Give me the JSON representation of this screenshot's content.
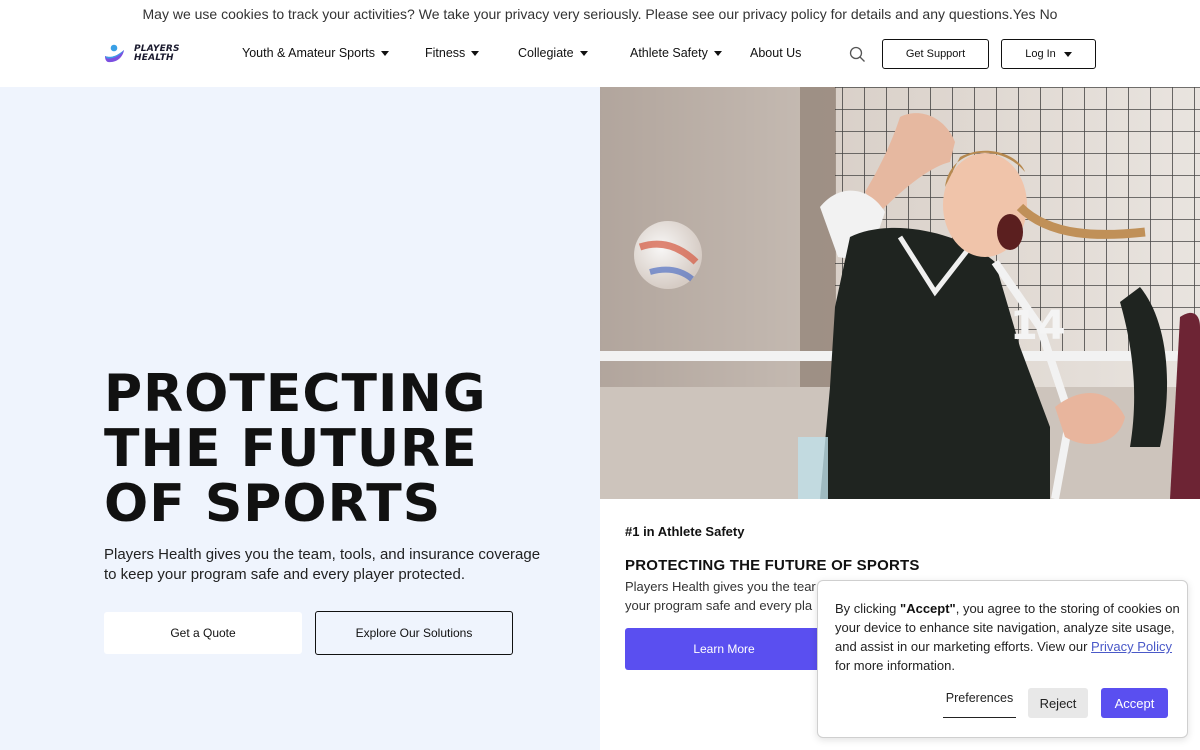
{
  "cookie_bar": {
    "message": "May we use cookies to track your activities? We take your privacy very seriously. Please see our privacy policy for details and any questions.",
    "yes": "Yes",
    "no": "No"
  },
  "header": {
    "logo_line1": "PLAYERS",
    "logo_line2": "HEALTH",
    "nav": [
      {
        "label": "Youth & Amateur Sports",
        "has_dropdown": true
      },
      {
        "label": "Fitness",
        "has_dropdown": true
      },
      {
        "label": "Collegiate",
        "has_dropdown": true
      },
      {
        "label": "Athlete Safety",
        "has_dropdown": true
      },
      {
        "label": "About Us",
        "has_dropdown": false
      }
    ],
    "search_icon": "search-icon",
    "get_support": "Get Support",
    "log_in": "Log In"
  },
  "hero": {
    "title_lines": [
      "PROTECTING",
      "THE FUTURE",
      "OF SPORTS"
    ],
    "subtitle": "Players Health gives you the team, tools, and insurance coverage to keep your program safe and every player protected.",
    "cta_primary": "Get a Quote",
    "cta_secondary": "Explore Our Solutions",
    "image_jersey_number": "14"
  },
  "card": {
    "kicker": "#1 in Athlete Safety",
    "title": "PROTECTING THE FUTURE OF SPORTS",
    "text_line1": "Players Health gives you the tear",
    "text_line2": "your program safe and every pla",
    "button": "Learn More"
  },
  "consent": {
    "prefix": "By clicking ",
    "accept_quote": "\"Accept\"",
    "body": ", you agree to the storing of cookies on your device to enhance site navigation, analyze site usage, and assist in our marketing efforts. View our ",
    "privacy_link": "Privacy Policy",
    "suffix": " for more information.",
    "preferences": "Preferences",
    "reject": "Reject",
    "accept": "Accept"
  },
  "colors": {
    "accent": "#5a4ff0",
    "hero_bg": "#eff4fd",
    "logo_blue": "#3aa0e6"
  }
}
